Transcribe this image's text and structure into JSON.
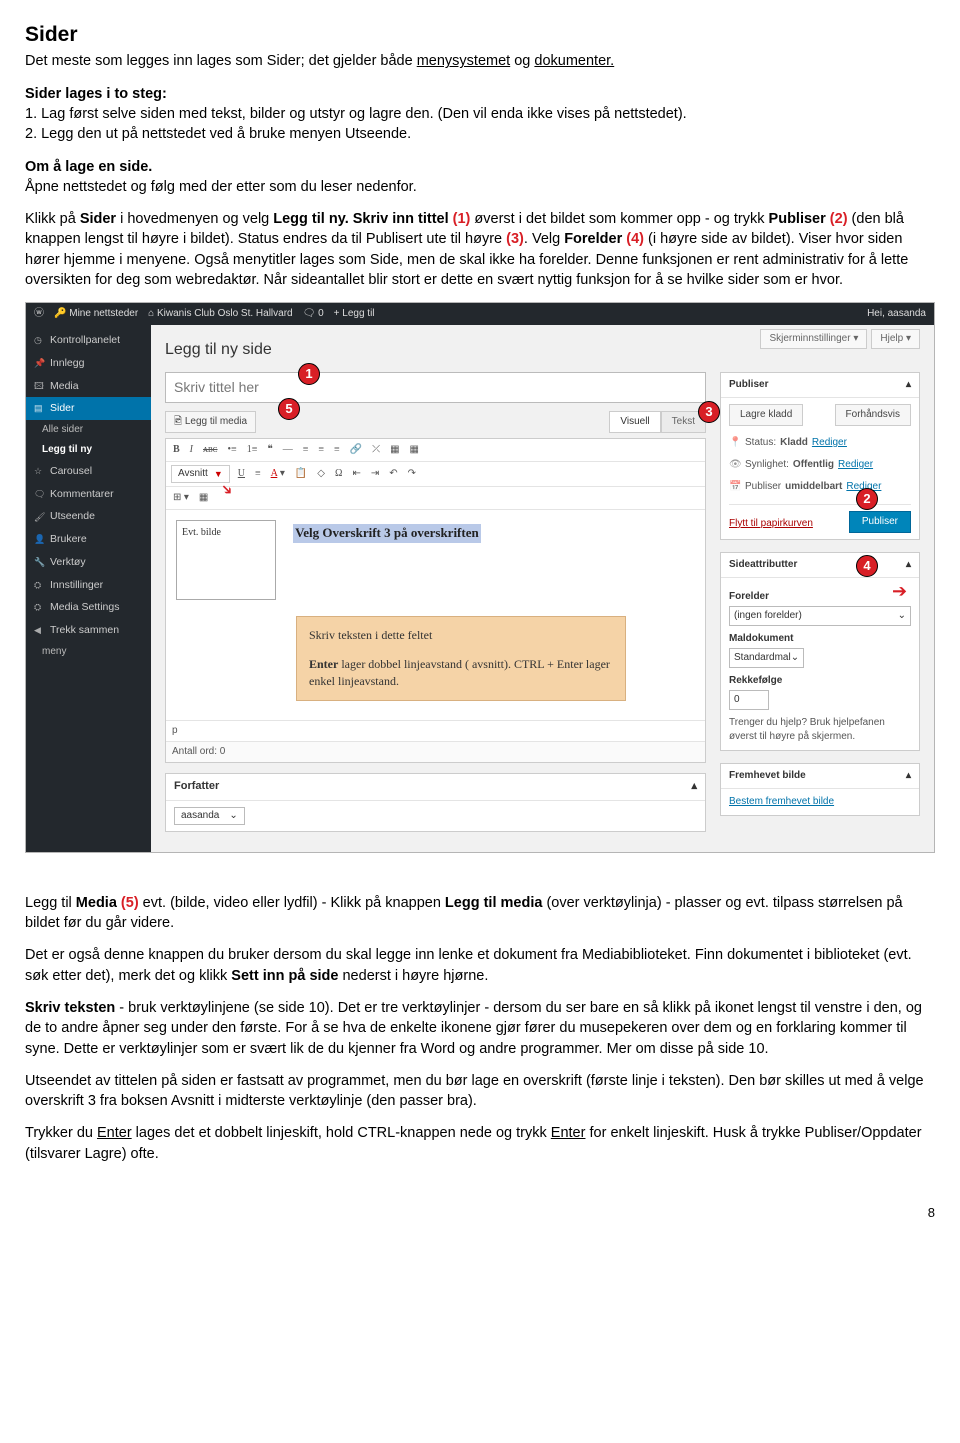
{
  "doc": {
    "h_sider": "Sider",
    "intro": "Det meste som legges inn lages som Sider; det gjelder både ",
    "intro_link1": "menysystemet",
    "intro_mid": " og ",
    "intro_link2": "dokumenter.",
    "lages": "Sider lages i to steg:",
    "step1": "1. Lag først selve siden med tekst, bilder og utstyr og lagre den. (Den vil enda ikke vises på nettstedet).",
    "step2": "2. Legg den ut på nettstedet ved å bruke menyen Utseende.",
    "omh": "Om å lage en side.",
    "oml": "Åpne nettstedet og følg med der etter som du leser nedenfor.",
    "para3a": "Klikk på ",
    "para3b": "Sider",
    "para3c": " i hovedmenyen og velg ",
    "para3d": "Legg til ny.  Skriv inn tittel ",
    "para3e": "(1)",
    "para3f": " øverst i det bildet som kommer opp - og trykk ",
    "para3g": "Publiser ",
    "para3h": "(2)",
    "para3i": " (den blå knappen lengst til høyre i bildet). Status endres da til Publisert ute til høyre ",
    "para3j": "(3)",
    "para3k": ". Velg ",
    "para3l": "Forelder ",
    "para3m": "(4)",
    "para3n": " (i høyre side av bildet). Viser hvor siden hører hjemme i menyene. Også menytitler lages som Side, men de skal ikke ha forelder. Denne funksjonen er rent administrativ for å lette oversikten for deg som webredaktør. Når sideantallet blir stort er dette en svært nyttig funksjon for å se hvilke sider som er hvor.",
    "aft1a": "Legg til ",
    "aft1b": "Media ",
    "aft1c": "(5)",
    "aft1d": " evt. (bilde, video eller lydfil) - Klikk på knappen ",
    "aft1e": "Legg til media",
    "aft1f": " (over verktøylinja) - plasser og evt. tilpass størrelsen på bildet før du går videre.",
    "aft2a": "Det er også denne knappen du bruker dersom du skal legge inn lenke et dokument fra Mediabiblioteket. Finn dokumentet i biblioteket (evt. søk etter det), merk det og klikk ",
    "aft2b": "Sett inn på side",
    "aft2c": " nederst i høyre hjørne.",
    "aft3a": "Skriv teksten",
    "aft3b": " - bruk verktøylinjene (se side 10). Det er tre verktøylinjer - dersom du ser bare en så klikk på ikonet lengst til venstre i den,  og de to andre åpner seg under den første. For å se hva de enkelte ikonene gjør fører du musepekeren over dem og en forklaring kommer til syne. Dette er verktøylinjer som er svært lik de du kjenner fra Word og andre programmer.  Mer om disse på side 10.",
    "aft4": "Utseendet av tittelen på siden er fastsatt av programmet, men du bør lage en overskrift (første linje i teksten). Den bør skilles ut med å velge overskrift 3 fra boksen Avsnitt i midterste verktøylinje (den passer bra).",
    "aft5a": "Trykker du ",
    "aft5b": "Enter",
    "aft5c": " lages det et dobbelt linjeskift, hold CTRL-knappen nede og trykk ",
    "aft5d": "Enter",
    "aft5e": " for enkelt linjeskift. Husk å trykke Publiser/Oppdater (tilsvarer Lagre) ofte.",
    "page_no": "8"
  },
  "wp": {
    "adminbar": {
      "mysites": "Mine nettsteder",
      "site": "Kiwanis Club Oslo St. Hallvard",
      "comments": "0",
      "new": "Legg til",
      "greeting": "Hei, aasanda"
    },
    "tabs": {
      "screen": "Skjerminnstillinger",
      "help": "Hjelp"
    },
    "menu": {
      "dashboard": "Kontrollpanelet",
      "posts": "Innlegg",
      "media": "Media",
      "pages": "Sider",
      "allpages": "Alle sider",
      "addnew": "Legg til ny",
      "carousel": "Carousel",
      "comments": "Kommentarer",
      "appearance": "Utseende",
      "users": "Brukere",
      "tools": "Verktøy",
      "settings": "Innstillinger",
      "mediasettings": "Media Settings",
      "collapse": "Trekk sammen",
      "menyline": "meny"
    },
    "page_title": "Legg til ny side",
    "title_placeholder": "Skriv tittel her",
    "add_media": "Legg til media",
    "edtab_visual": "Visuell",
    "edtab_text": "Tekst",
    "para_dropdown": "Avsnitt",
    "img_ph": "Evt. bilde",
    "sel_heading": "Velg Overskrift 3 på overskriften",
    "tan1": "Skriv teksten i dette feltet",
    "tan2a": "Enter",
    "tan2b": "  lager dobbel linjeavstand ( avsnitt). CTRL + Enter lager enkel linjeavstand.",
    "footer_p": "p",
    "word_count": "Antall ord: 0",
    "author_label": "Forfatter",
    "author_val": "aasanda",
    "publish_box": {
      "title": "Publiser",
      "save_draft": "Lagre kladd",
      "preview": "Forhåndsvis",
      "status_l": "Status:",
      "status_v": "Kladd",
      "edit": "Rediger",
      "vis_l": "Synlighet:",
      "vis_v": "Offentlig",
      "time_l": "Publiser",
      "time_v": "umiddelbart",
      "trash": "Flytt til papirkurven",
      "publish_btn": "Publiser"
    },
    "attr_box": {
      "title": "Sideattributter",
      "parent_l": "Forelder",
      "parent_v": "(ingen forelder)",
      "tmpl_l": "Maldokument",
      "tmpl_v": "Standardmal",
      "order_l": "Rekkefølge",
      "order_v": "0",
      "help": "Trenger du hjelp? Bruk hjelpefanen øverst til høyre på skjermen."
    },
    "feat_box": {
      "title": "Fremhevet bilde",
      "link": "Bestem fremhevet bilde"
    }
  },
  "badges": {
    "b1": "1",
    "b2": "2",
    "b3": "3",
    "b4": "4",
    "b5": "5"
  }
}
